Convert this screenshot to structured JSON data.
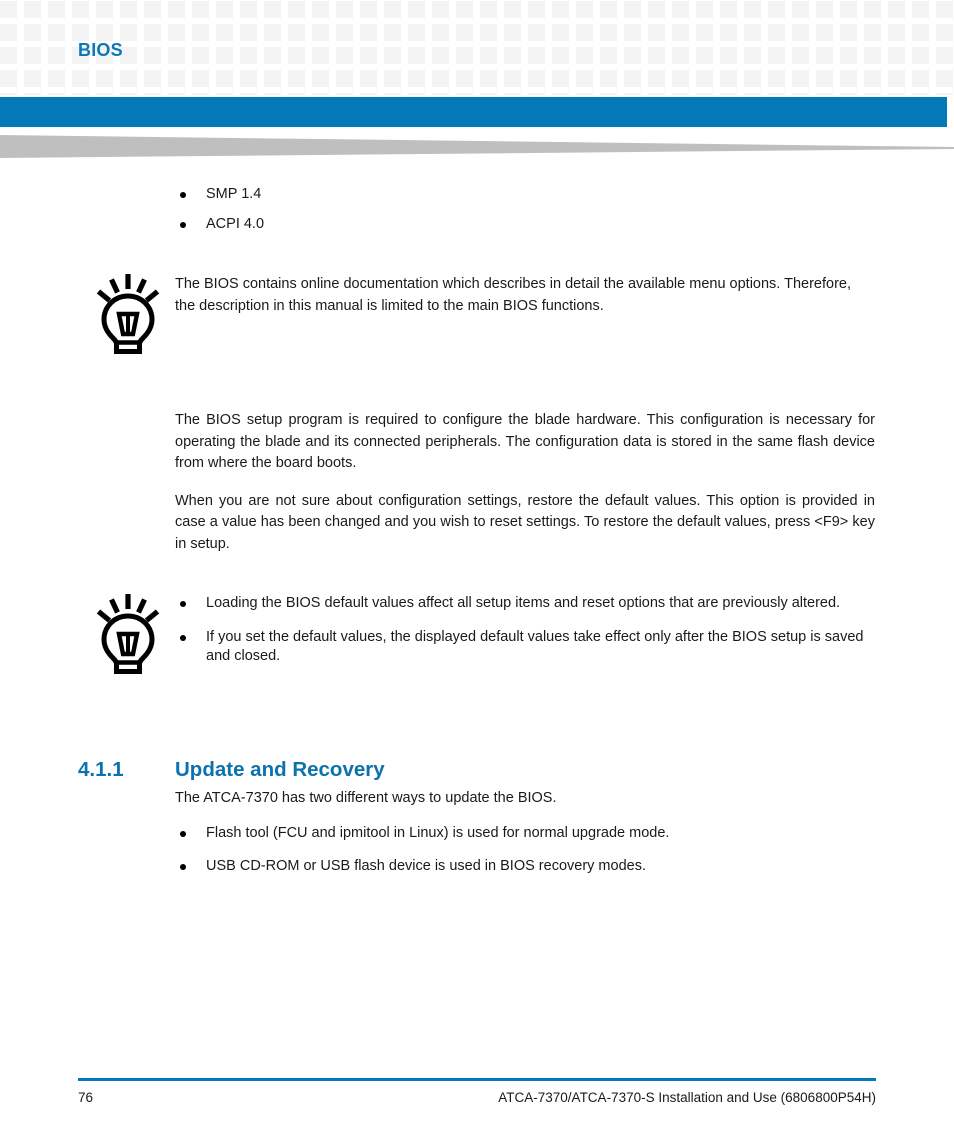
{
  "header": {
    "title": "BIOS",
    "accent_color": "#0479b9",
    "title_color": "#0b78b8",
    "grid_square_color": "#f3f3f3",
    "wedge_color": "#bfbfbf"
  },
  "content": {
    "spec_list": [
      "SMP 1.4",
      "ACPI 4.0"
    ],
    "tip_one": {
      "icon": "lightbulb-tip-icon",
      "text": "The BIOS contains online documentation which describes in detail the available menu options. Therefore, the description in this manual is limited to the main BIOS functions."
    },
    "paragraphs": [
      "The BIOS setup program is required to configure the blade hardware. This configuration is necessary for operating the blade and its connected peripherals. The configuration data is stored in the same flash device from where the board boots.",
      "When you are not sure about configuration settings, restore the default values. This option is provided in case a value has been changed and you wish to reset settings. To restore the default values, press <F9> key in setup."
    ],
    "tip_two": {
      "icon": "lightbulb-tip-icon",
      "bullets": [
        "Loading the BIOS default values affect all setup items and reset options that are previously altered.",
        "If you set the default values, the displayed default values take effect only after the BIOS setup is saved and closed."
      ]
    },
    "section": {
      "number": "4.1.1",
      "title": "Update and Recovery",
      "color": "#0b72ad",
      "intro": "The ATCA-7370 has two different ways to update the BIOS.",
      "bullets": [
        "Flash tool (FCU and ipmitool in Linux) is used for normal upgrade mode.",
        "USB CD-ROM or USB flash device is used in BIOS recovery modes."
      ]
    }
  },
  "footer": {
    "page_number": "76",
    "document_title": "ATCA-7370/ATCA-7370-S Installation and Use (6806800P54H)",
    "rule_color": "#0479b9"
  }
}
